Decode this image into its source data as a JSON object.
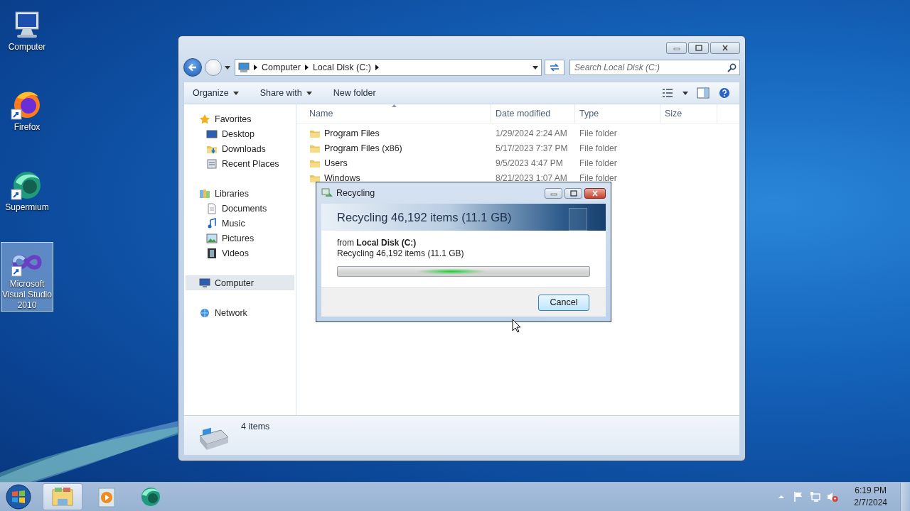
{
  "desktop_icons": [
    {
      "label": "Computer",
      "selected": false
    },
    {
      "label": "Firefox",
      "selected": false
    },
    {
      "label": "Supermium",
      "selected": false
    },
    {
      "label": "Microsoft Visual Studio 2010",
      "selected": true
    }
  ],
  "explorer": {
    "address": {
      "crumbs": [
        "Computer",
        "Local Disk (C:)"
      ]
    },
    "search": {
      "placeholder": "Search Local Disk (C:)"
    },
    "toolbar": {
      "buttons": [
        {
          "label": "Organize",
          "menu": true
        },
        {
          "label": "Share with",
          "menu": true
        },
        {
          "label": "New folder",
          "menu": false
        }
      ]
    },
    "navigation": [
      {
        "label": "Favorites",
        "selected": false,
        "children": [
          {
            "label": "Desktop",
            "selected": false
          },
          {
            "label": "Downloads",
            "selected": false
          },
          {
            "label": "Recent Places",
            "selected": false
          }
        ]
      },
      {
        "label": "Libraries",
        "selected": false,
        "children": [
          {
            "label": "Documents",
            "selected": false
          },
          {
            "label": "Music",
            "selected": false
          },
          {
            "label": "Pictures",
            "selected": false
          },
          {
            "label": "Videos",
            "selected": false
          }
        ]
      },
      {
        "label": "Computer",
        "selected": true
      },
      {
        "label": "Network",
        "selected": false
      }
    ],
    "table": {
      "columns": [
        {
          "label": "Name",
          "sorted": true
        },
        {
          "label": "Date modified",
          "sorted": false
        },
        {
          "label": "Type",
          "sorted": false
        },
        {
          "label": "Size",
          "sorted": false
        }
      ],
      "rows": [
        [
          "Program Files",
          "1/29/2024 2:24 AM",
          "File folder"
        ],
        [
          "Program Files (x86)",
          "5/17/2023 7:37 PM",
          "File folder"
        ],
        [
          "Users",
          "9/5/2023 4:47 PM",
          "File folder"
        ],
        [
          "Windows",
          "8/21/2023 1:07 AM",
          "File folder"
        ]
      ]
    },
    "details": {
      "count": "4 items"
    }
  },
  "dialog": {
    "title": "Recycling",
    "heading": "Recycling 46,192 items (11.1 GB)",
    "source": "from **Local Disk (C:)**",
    "status": "Recycling 46,192 items (11.1 GB)",
    "marquee": true,
    "button": "Cancel"
  },
  "taskbar": {
    "buttons": [
      {
        "selected": true
      },
      {
        "selected": false
      },
      {
        "selected": false
      }
    ],
    "time": "6:19 PM",
    "date": "2/7/2024"
  }
}
